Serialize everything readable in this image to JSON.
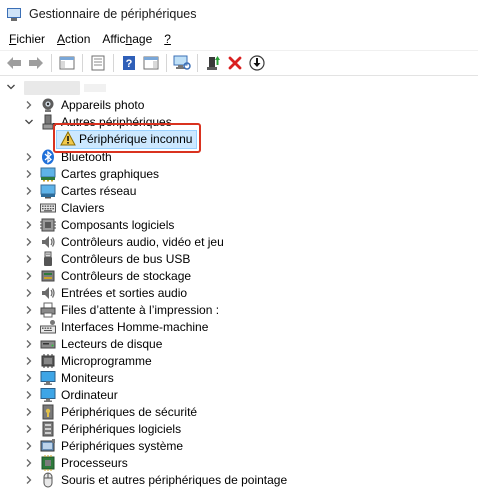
{
  "window": {
    "title": "Gestionnaire de périphériques"
  },
  "menu": [
    {
      "key": "F",
      "rest": "ichier"
    },
    {
      "key": "A",
      "rest": "ction"
    },
    {
      "pre": "Affic",
      "key": "h",
      "rest": "age"
    },
    {
      "key": "?",
      "rest": ""
    }
  ],
  "toolbar": {
    "buttons": [
      "back-icon",
      "forward-icon",
      "show-hide-console-tree-icon",
      "properties-icon",
      "help-icon",
      "action-pane-icon",
      "scan-hardware-icon",
      "update-driver-icon",
      "uninstall-device-icon",
      "disable-device-icon"
    ]
  },
  "tree": {
    "categories": [
      {
        "label": "Appareils photo",
        "icon": "camera-icon",
        "expanded": false
      },
      {
        "label": "Autres périphériques",
        "icon": "other-devices-icon",
        "expanded": true,
        "children": [
          {
            "label": "Périphérique inconnu",
            "icon": "unknown-device-warning-icon",
            "selected": true
          }
        ]
      },
      {
        "label": "Bluetooth",
        "icon": "bluetooth-icon",
        "expanded": false
      },
      {
        "label": "Cartes graphiques",
        "icon": "display-adapter-icon",
        "expanded": false
      },
      {
        "label": "Cartes réseau",
        "icon": "network-adapter-icon",
        "expanded": false
      },
      {
        "label": "Claviers",
        "icon": "keyboard-icon",
        "expanded": false
      },
      {
        "label": "Composants logiciels",
        "icon": "software-component-icon",
        "expanded": false
      },
      {
        "label": "Contrôleurs audio, vidéo et jeu",
        "icon": "audio-icon",
        "expanded": false
      },
      {
        "label": "Contrôleurs de bus USB",
        "icon": "usb-icon",
        "expanded": false
      },
      {
        "label": "Contrôleurs de stockage",
        "icon": "storage-controller-icon",
        "expanded": false
      },
      {
        "label": "Entrées et sorties audio",
        "icon": "audio-io-icon",
        "expanded": false
      },
      {
        "label": "Files d’attente à l’impression :",
        "icon": "print-queue-icon",
        "expanded": false
      },
      {
        "label": "Interfaces Homme-machine",
        "icon": "hid-icon",
        "expanded": false
      },
      {
        "label": "Lecteurs de disque",
        "icon": "disk-drive-icon",
        "expanded": false
      },
      {
        "label": "Microprogramme",
        "icon": "firmware-icon",
        "expanded": false
      },
      {
        "label": "Moniteurs",
        "icon": "monitor-icon",
        "expanded": false
      },
      {
        "label": "Ordinateur",
        "icon": "computer-icon",
        "expanded": false
      },
      {
        "label": "Périphériques de sécurité",
        "icon": "security-device-icon",
        "expanded": false
      },
      {
        "label": "Périphériques logiciels",
        "icon": "software-device-icon",
        "expanded": false
      },
      {
        "label": "Périphériques système",
        "icon": "system-device-icon",
        "expanded": false
      },
      {
        "label": "Processeurs",
        "icon": "processor-icon",
        "expanded": false
      },
      {
        "label": "Souris et autres périphériques de pointage",
        "icon": "mouse-icon",
        "expanded": false
      }
    ]
  },
  "colors": {
    "selection_bg": "#cce8ff",
    "selection_border": "#99d1ff",
    "highlight": "#d9321f"
  }
}
